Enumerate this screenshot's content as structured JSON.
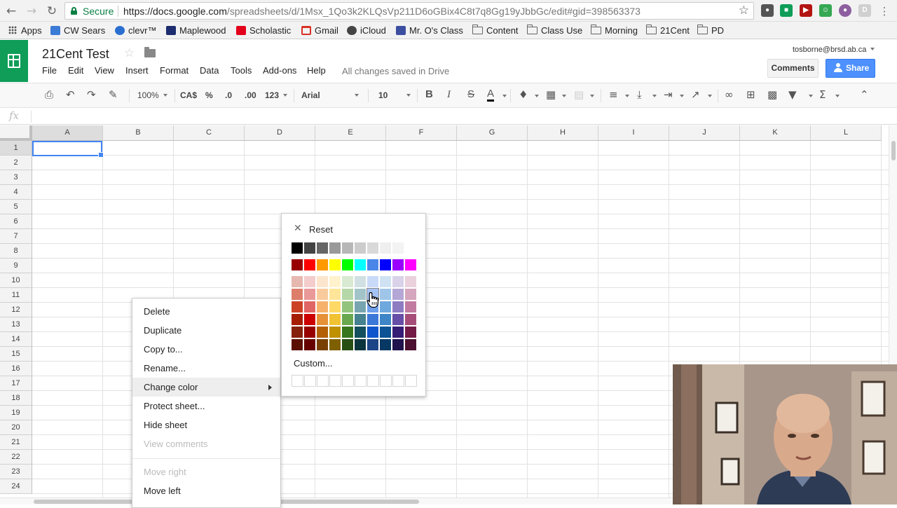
{
  "browser": {
    "secure_label": "Secure",
    "url_host": "https://docs.google.com",
    "url_path": "/spreadsheets/d/1Msx_1Qo3k2KLQsVp211D6oGBix4C8t7q8Gg19yJbbGc/edit#gid=398563373",
    "extension_letter": "D"
  },
  "bookmarks": [
    {
      "label": "Apps",
      "icon": "apps-grid-icon"
    },
    {
      "label": "CW Sears",
      "icon": "cw-sears-icon",
      "color": "#3a7bd5"
    },
    {
      "label": "clevr™",
      "icon": "clever-icon",
      "color": "#2a6fd0"
    },
    {
      "label": "Maplewood",
      "icon": "maplewood-icon",
      "color": "#1c2c6e"
    },
    {
      "label": "Scholastic",
      "icon": "scholastic-icon",
      "color": "#e3001b"
    },
    {
      "label": "Gmail",
      "icon": "gmail-icon",
      "color": "#d93025"
    },
    {
      "label": "iCloud",
      "icon": "icloud-icon",
      "color": "#444444"
    },
    {
      "label": "Mr. O's Class",
      "icon": "calendar-icon",
      "color": "#3c4ea0"
    },
    {
      "label": "Content",
      "icon": "folder-icon"
    },
    {
      "label": "Class Use",
      "icon": "folder-icon"
    },
    {
      "label": "Morning",
      "icon": "folder-icon"
    },
    {
      "label": "21Cent",
      "icon": "folder-icon"
    },
    {
      "label": "PD",
      "icon": "folder-icon"
    }
  ],
  "doc": {
    "title": "21Cent Test",
    "saved_status": "All changes saved in Drive",
    "account": "tosborne@brsd.ab.ca",
    "comments_label": "Comments",
    "share_label": "Share"
  },
  "menus": [
    "File",
    "Edit",
    "View",
    "Insert",
    "Format",
    "Data",
    "Tools",
    "Add-ons",
    "Help"
  ],
  "toolbar": {
    "zoom": "100%",
    "currency": "CA$",
    "percent": "%",
    "dec_less": ".0",
    "dec_more": ".00",
    "more_formats": "123",
    "font": "Arial",
    "font_size": "10",
    "bold": "B",
    "italic": "I",
    "strike": "S",
    "text_color": "A"
  },
  "formula_bar": {
    "fx": "fx"
  },
  "grid": {
    "columns": [
      "A",
      "B",
      "C",
      "D",
      "E",
      "F",
      "G",
      "H",
      "I",
      "J",
      "K",
      "L"
    ],
    "rows": [
      "1",
      "2",
      "3",
      "4",
      "5",
      "6",
      "7",
      "8",
      "9",
      "10",
      "11",
      "12",
      "13",
      "14",
      "15",
      "16",
      "17",
      "18",
      "19",
      "20",
      "21",
      "22",
      "23",
      "24"
    ],
    "selected_cell": "A1"
  },
  "context_menu": {
    "items": [
      {
        "label": "Delete",
        "disabled": false
      },
      {
        "label": "Duplicate",
        "disabled": false
      },
      {
        "label": "Copy to...",
        "disabled": false
      },
      {
        "label": "Rename...",
        "disabled": false
      },
      {
        "label": "Change color",
        "disabled": false,
        "submenu": true,
        "highlighted": true
      },
      {
        "label": "Protect sheet...",
        "disabled": false
      },
      {
        "label": "Hide sheet",
        "disabled": false
      },
      {
        "label": "View comments",
        "disabled": true
      },
      {
        "label": "Move right",
        "disabled": true
      },
      {
        "label": "Move left",
        "disabled": false
      }
    ]
  },
  "color_palette": {
    "reset_label": "Reset",
    "custom_label": "Custom...",
    "grays": [
      "#000000",
      "#434343",
      "#666666",
      "#999999",
      "#b7b7b7",
      "#cccccc",
      "#d9d9d9",
      "#efefef",
      "#f3f3f3",
      "#ffffff"
    ],
    "brights": [
      "#980000",
      "#ff0000",
      "#ff9900",
      "#ffff00",
      "#00ff00",
      "#00ffff",
      "#4a86e8",
      "#0000ff",
      "#9900ff",
      "#ff00ff"
    ],
    "shades": [
      [
        "#e6b8af",
        "#f4cccc",
        "#fce5cd",
        "#fff2cc",
        "#d9ead3",
        "#d0e0e3",
        "#c9daf8",
        "#cfe2f3",
        "#d9d2e9",
        "#ead1dc"
      ],
      [
        "#dd7e6b",
        "#ea9999",
        "#f9cb9c",
        "#ffe599",
        "#b6d7a8",
        "#a2c4c9",
        "#a4c2f4",
        "#9fc5e8",
        "#b4a7d6",
        "#d5a6bd"
      ],
      [
        "#cc4125",
        "#e06666",
        "#f6b26b",
        "#ffd966",
        "#93c47d",
        "#76a5af",
        "#6d9eeb",
        "#6fa8dc",
        "#8e7cc3",
        "#c27ba0"
      ],
      [
        "#a61c00",
        "#cc0000",
        "#e69138",
        "#f1c232",
        "#6aa84f",
        "#45818e",
        "#3c78d8",
        "#3d85c6",
        "#674ea7",
        "#a64d79"
      ],
      [
        "#85200c",
        "#990000",
        "#b45f06",
        "#bf9000",
        "#38761d",
        "#134f5c",
        "#1155cc",
        "#0b5394",
        "#351c75",
        "#741b47"
      ],
      [
        "#5b0f00",
        "#660000",
        "#783f04",
        "#7f6000",
        "#274e13",
        "#0c343d",
        "#1c4587",
        "#073763",
        "#20124d",
        "#4c1130"
      ]
    ],
    "hovered": {
      "row": 1,
      "col": 6
    }
  }
}
